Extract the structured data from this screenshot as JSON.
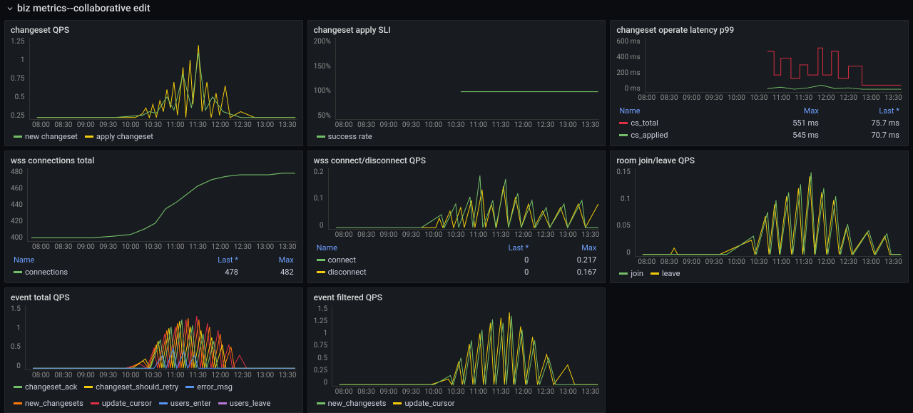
{
  "header": {
    "title": "biz metrics--collaborative edit"
  },
  "panels": {
    "p1": {
      "title": "changeset QPS"
    },
    "p2": {
      "title": "changeset apply SLI"
    },
    "p3": {
      "title": "changeset operate latency p99"
    },
    "p4": {
      "title": "wss connections total"
    },
    "p5": {
      "title": "wss connect/disconnect QPS"
    },
    "p6": {
      "title": "room join/leave QPS"
    },
    "p7": {
      "title": "event total QPS"
    },
    "p8": {
      "title": "event filtered QPS"
    }
  },
  "yAxes": {
    "p1": [
      "1.25",
      "1",
      "0.75",
      "0.5",
      "0.25"
    ],
    "p2": [
      "200%",
      "150%",
      "100%",
      "50%"
    ],
    "p3": [
      "600 ms",
      "400 ms",
      "200 ms",
      "0 ms"
    ],
    "p4": [
      "480",
      "460",
      "440",
      "420",
      "400"
    ],
    "p5": [
      "0.2",
      "0.1",
      "0"
    ],
    "p6": [
      "0.15",
      "0.1",
      "0.05",
      "0"
    ],
    "p7": [
      "1.5",
      "1",
      "0.5",
      "0"
    ],
    "p8": [
      "1.5",
      "1.25",
      "1",
      "0.75",
      "0.5",
      "0.25",
      "0"
    ]
  },
  "xTicks": [
    "08:00",
    "08:30",
    "09:00",
    "09:30",
    "10:00",
    "10:30",
    "11:00",
    "11:30",
    "12:00",
    "12:30",
    "13:00",
    "13:30"
  ],
  "legends": {
    "p1": [
      {
        "color": "#73bf69",
        "label": "new changeset"
      },
      {
        "color": "#f2cc0c",
        "label": "apply changeset"
      }
    ],
    "p2": [
      {
        "color": "#73bf69",
        "label": "success rate"
      }
    ],
    "p6": [
      {
        "color": "#73bf69",
        "label": "join"
      },
      {
        "color": "#f2cc0c",
        "label": "leave"
      }
    ],
    "p7": [
      {
        "color": "#73bf69",
        "label": "changeset_ack"
      },
      {
        "color": "#f2cc0c",
        "label": "changeset_should_retry"
      },
      {
        "color": "#5794f2",
        "label": "error_msg"
      },
      {
        "color": "#ff780a",
        "label": "new_changesets"
      },
      {
        "color": "#e02f44",
        "label": "update_cursor"
      },
      {
        "color": "#5794f2",
        "label": "users_enter"
      },
      {
        "color": "#b877d9",
        "label": "users_leave"
      }
    ],
    "p8": [
      {
        "color": "#73bf69",
        "label": "new_changesets"
      },
      {
        "color": "#f2cc0c",
        "label": "update_cursor"
      }
    ]
  },
  "tableLegends": {
    "p3": {
      "headers": [
        "Name",
        "Max",
        "Last *"
      ],
      "rows": [
        {
          "color": "#e02f44",
          "name": "cs_total",
          "max": "551 ms",
          "last": "75.7 ms"
        },
        {
          "color": "#73bf69",
          "name": "cs_applied",
          "max": "545 ms",
          "last": "70.7 ms"
        }
      ]
    },
    "p4": {
      "headers": [
        "Name",
        "Last *",
        "Max"
      ],
      "rows": [
        {
          "color": "#73bf69",
          "name": "connections",
          "last": "478",
          "max": "482"
        }
      ]
    },
    "p5": {
      "headers": [
        "Name",
        "Last *",
        "Max"
      ],
      "rows": [
        {
          "color": "#73bf69",
          "name": "connect",
          "last": "0",
          "max": "0.217"
        },
        {
          "color": "#f2cc0c",
          "name": "disconnect",
          "last": "0",
          "max": "0.167"
        }
      ]
    }
  },
  "chart_data": [
    {
      "panel": "changeset QPS",
      "type": "line",
      "x_range": [
        "08:00",
        "13:45"
      ],
      "ylim": [
        0,
        1.25
      ],
      "series": [
        {
          "name": "new changeset",
          "color": "#73bf69",
          "description": "mostly zero, bursts 10:30-12:30 peaking ~1.2 near 11:50"
        },
        {
          "name": "apply changeset",
          "color": "#f2cc0c",
          "description": "mostly zero, bursts 10:30-12:30 peaking ~1.2 near 11:50"
        }
      ]
    },
    {
      "panel": "changeset apply SLI",
      "type": "line",
      "x_range": [
        "08:00",
        "13:45"
      ],
      "ylim": [
        50,
        200
      ],
      "yunit": "%",
      "series": [
        {
          "name": "success rate",
          "color": "#73bf69",
          "values_description": "flat at 100% over whole range"
        }
      ]
    },
    {
      "panel": "changeset operate latency p99",
      "type": "line",
      "x_range": [
        "08:00",
        "13:45"
      ],
      "ylim": [
        0,
        600
      ],
      "yunit": "ms",
      "series": [
        {
          "name": "cs_total",
          "color": "#e02f44",
          "max": 551,
          "last": 75.7,
          "description": "step-like red trace 10:30-13:00, plateaus ~200-550ms"
        },
        {
          "name": "cs_applied",
          "color": "#73bf69",
          "max": 545,
          "last": 70.7,
          "description": "low green trace near baseline with small bumps"
        }
      ]
    },
    {
      "panel": "wss connections total",
      "type": "line",
      "x_range": [
        "08:00",
        "13:45"
      ],
      "ylim": [
        400,
        490
      ],
      "series": [
        {
          "name": "connections",
          "color": "#73bf69",
          "last": 478,
          "max": 482,
          "description": "flat ~400 until 10:30, rises to ~480 by 12:00 then plateau"
        }
      ]
    },
    {
      "panel": "wss connect/disconnect QPS",
      "type": "line",
      "x_range": [
        "08:00",
        "13:45"
      ],
      "ylim": [
        0,
        0.22
      ],
      "series": [
        {
          "name": "connect",
          "color": "#73bf69",
          "last": 0,
          "max": 0.217,
          "description": "spiky bursts 10:30-13:45 up to ~0.22"
        },
        {
          "name": "disconnect",
          "color": "#f2cc0c",
          "last": 0,
          "max": 0.167,
          "description": "spiky bursts 10:30-13:45 up to ~0.17"
        }
      ]
    },
    {
      "panel": "room join/leave QPS",
      "type": "line",
      "x_range": [
        "08:00",
        "13:45"
      ],
      "ylim": [
        0,
        0.18
      ],
      "series": [
        {
          "name": "join",
          "color": "#73bf69",
          "description": "spiky bursts 10:30-13:00 up to ~0.17"
        },
        {
          "name": "leave",
          "color": "#f2cc0c",
          "description": "spiky bursts 10:30-13:00 up to ~0.15"
        }
      ]
    },
    {
      "panel": "event total QPS",
      "type": "line",
      "x_range": [
        "08:00",
        "13:45"
      ],
      "ylim": [
        0,
        1.6
      ],
      "series": [
        {
          "name": "changeset_ack",
          "color": "#73bf69"
        },
        {
          "name": "changeset_should_retry",
          "color": "#f2cc0c"
        },
        {
          "name": "error_msg",
          "color": "#5794f2"
        },
        {
          "name": "new_changesets",
          "color": "#ff780a"
        },
        {
          "name": "update_cursor",
          "color": "#e02f44"
        },
        {
          "name": "users_enter",
          "color": "#5794f2"
        },
        {
          "name": "users_leave",
          "color": "#b877d9"
        }
      ],
      "description": "multi-colored dense spikes mostly 10:30-12:30, peak ~1.5"
    },
    {
      "panel": "event filtered QPS",
      "type": "line",
      "x_range": [
        "08:00",
        "13:45"
      ],
      "ylim": [
        0,
        1.5
      ],
      "series": [
        {
          "name": "new_changesets",
          "color": "#73bf69"
        },
        {
          "name": "update_cursor",
          "color": "#f2cc0c"
        }
      ],
      "description": "spiky bursts 10:30-12:30 peaking ~1.4"
    }
  ]
}
